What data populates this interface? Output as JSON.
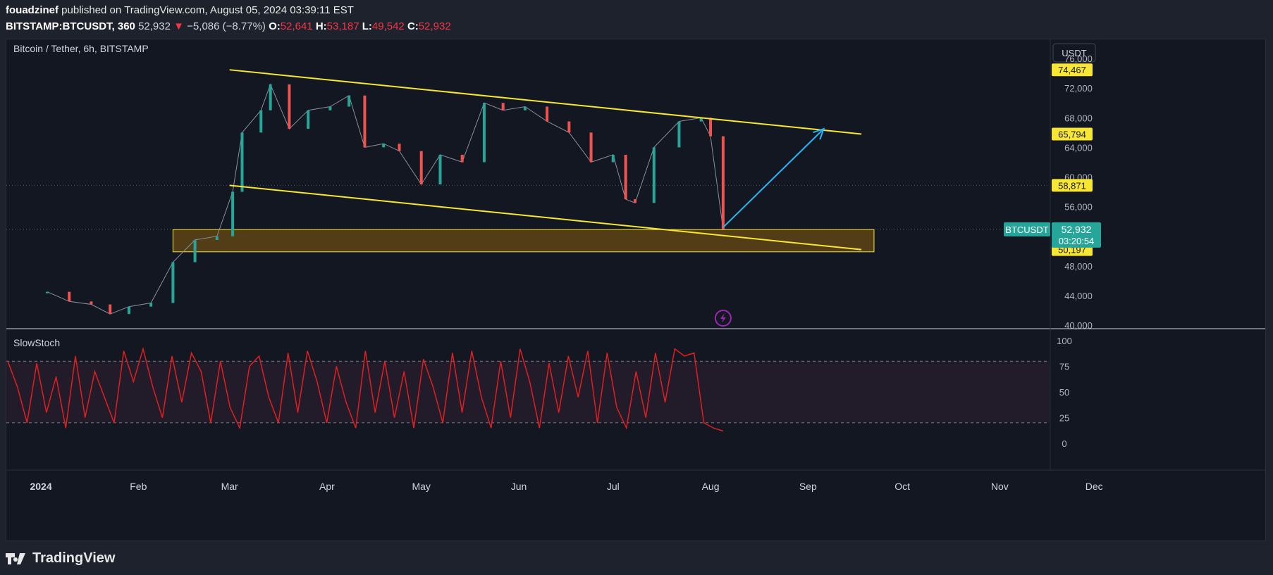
{
  "header": {
    "author": "fouadzinef",
    "published_text": " published on TradingView.com, August 05, 2024 03:39:11 EST",
    "symbol": "BITSTAMP:BTCUSDT, 360",
    "last": "52,932",
    "change_arrow": "▼",
    "change": "−5,086 (−8.77%)",
    "o_label": "O:",
    "o": "52,641",
    "h_label": "H:",
    "h": "53,187",
    "l_label": "L:",
    "l": "49,542",
    "c_label": "C:",
    "c": "52,932"
  },
  "chart": {
    "title": "Bitcoin / Tether, 6h, BITSTAMP",
    "currency_button": "USDT",
    "price_ticks": [
      "76,000",
      "72,000",
      "68,000",
      "64,000",
      "60,000",
      "56,000",
      "52,000",
      "48,000",
      "44,000",
      "40,000"
    ],
    "price_tags": [
      {
        "label": "74,467",
        "value": 74467,
        "color": "#f7e633"
      },
      {
        "label": "65,794",
        "value": 65794,
        "color": "#f7e633"
      },
      {
        "label": "58,871",
        "value": 58871,
        "color": "#f7e633"
      },
      {
        "label": "50,197",
        "value": 50197,
        "color": "#f7e633"
      }
    ],
    "symbol_tag": "BTCUSDT",
    "last_price_tag": "52,932",
    "countdown": "03:20:54",
    "x_ticks": [
      "2024",
      "Feb",
      "Mar",
      "Apr",
      "May",
      "Jun",
      "Jul",
      "Aug",
      "Sep",
      "Oct",
      "Nov",
      "Dec"
    ],
    "indicator_name": "SlowStoch",
    "stoch_ticks": [
      "100",
      "75",
      "50",
      "25",
      "0"
    ],
    "colors": {
      "up": "#26a69a",
      "down": "#ef5350",
      "trendline": "#f7e633",
      "arrow": "#29b6f6",
      "zone": "#5e4415",
      "stoch": "#e01f1f",
      "accent": "#26a69a"
    }
  },
  "chart_data": {
    "type": "line",
    "title": "Bitcoin / Tether, 6h, BITSTAMP",
    "x": [
      "Jan 3",
      "Jan 10",
      "Jan 17",
      "Jan 23",
      "Jan 29",
      "Feb 5",
      "Feb 12",
      "Feb 19",
      "Feb 26",
      "Mar 2",
      "Mar 5",
      "Mar 11",
      "Mar 14",
      "Mar 20",
      "Mar 26",
      "Apr 2",
      "Apr 8",
      "Apr 13",
      "Apr 19",
      "Apr 24",
      "May 1",
      "May 7",
      "May 14",
      "May 21",
      "May 27",
      "Jun 3",
      "Jun 10",
      "Jun 17",
      "Jun 24",
      "Jul 1",
      "Jul 5",
      "Jul 8",
      "Jul 14",
      "Jul 22",
      "Jul 29",
      "Aug 1",
      "Aug 5"
    ],
    "series": [
      {
        "values": [
          44500,
          43200,
          42800,
          41500,
          42500,
          43000,
          48500,
          51500,
          52000,
          58000,
          66000,
          69000,
          72500,
          66500,
          69000,
          69500,
          71000,
          64000,
          64500,
          63500,
          59000,
          63000,
          62000,
          70000,
          69000,
          69500,
          67500,
          66000,
          62000,
          63000,
          57000,
          56500,
          64000,
          67500,
          68000,
          65500,
          52932
        ]
      }
    ],
    "ylim": [
      40000,
      78000
    ],
    "annotations": {
      "channel_upper": [
        [
          "Mar 1",
          74467
        ],
        [
          "Sep 18",
          65794
        ]
      ],
      "channel_lower": [
        [
          "Mar 1",
          58871
        ],
        [
          "Sep 18",
          50197
        ]
      ],
      "support_zone": {
        "from": "Feb 12",
        "to": "Sep 22",
        "low": 49900,
        "high": 52900
      },
      "projection_arrow": [
        [
          "Aug 5",
          53200
        ],
        [
          "Sep 6",
          66500
        ]
      ]
    },
    "slowstoch": {
      "ylim": [
        0,
        100
      ],
      "bands": [
        20,
        80
      ],
      "values": [
        80,
        55,
        20,
        78,
        30,
        65,
        15,
        85,
        25,
        70,
        45,
        20,
        90,
        60,
        92,
        55,
        25,
        85,
        40,
        88,
        70,
        20,
        80,
        35,
        15,
        75,
        85,
        45,
        20,
        88,
        30,
        90,
        60,
        20,
        75,
        40,
        15,
        90,
        30,
        80,
        25,
        70,
        15,
        82,
        55,
        20,
        88,
        30,
        90,
        45,
        15,
        80,
        25,
        92,
        60,
        15,
        78,
        30,
        85,
        45,
        90,
        20,
        88,
        35,
        15,
        70,
        25,
        88,
        40,
        92,
        85,
        88,
        20,
        15,
        12
      ]
    }
  }
}
